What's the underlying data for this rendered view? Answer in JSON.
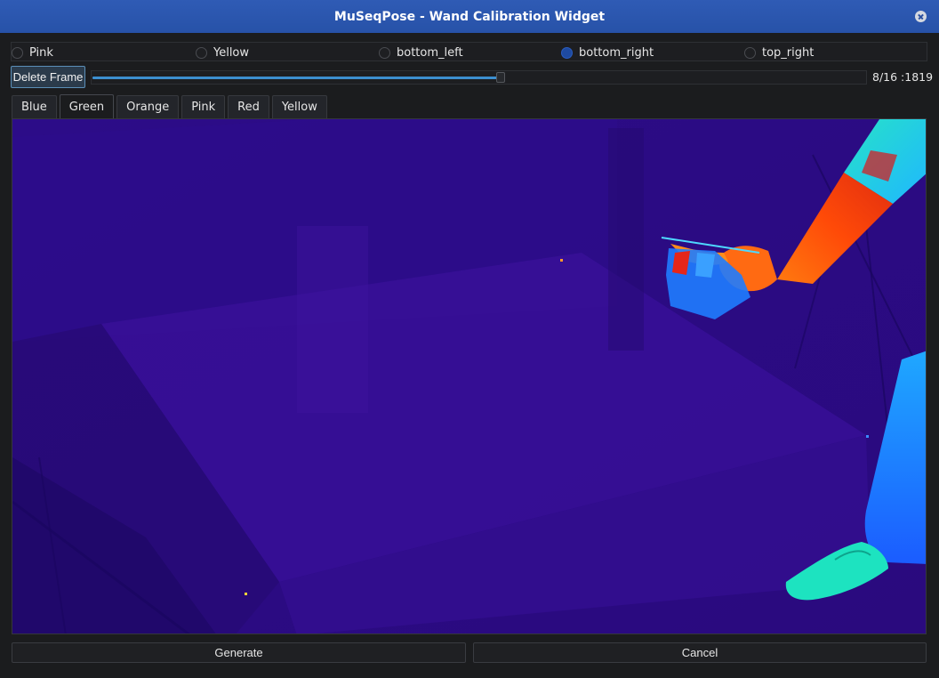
{
  "window": {
    "title": "MuSeqPose - Wand Calibration Widget"
  },
  "radio_options": [
    {
      "label": "Pink",
      "checked": false
    },
    {
      "label": "Yellow",
      "checked": false
    },
    {
      "label": "bottom_left",
      "checked": false
    },
    {
      "label": "bottom_right",
      "checked": true
    },
    {
      "label": "top_right",
      "checked": false
    }
  ],
  "controls": {
    "delete_label": "Delete Frame",
    "frame_label": "8/16 :1819",
    "frame_current": 8,
    "frame_total": 16
  },
  "tabs": [
    {
      "label": "Blue",
      "active": false
    },
    {
      "label": "Green",
      "active": true
    },
    {
      "label": "Orange",
      "active": false
    },
    {
      "label": "Pink",
      "active": false
    },
    {
      "label": "Red",
      "active": false
    },
    {
      "label": "Yellow",
      "active": false
    }
  ],
  "buttons": {
    "generate_label": "Generate",
    "cancel_label": "Cancel"
  },
  "colors": {
    "accent": "#3c8fd0",
    "titlebar": "#2752a8",
    "thermal_bg": "#2a0a85"
  }
}
